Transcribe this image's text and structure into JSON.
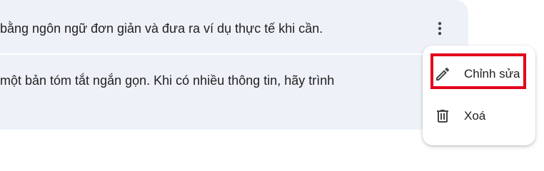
{
  "list": {
    "rows": [
      {
        "text": "bằng ngôn ngữ đơn giản và đưa ra ví dụ thực tế khi cần."
      },
      {
        "text": "một bản tóm tắt ngắn gọn. Khi có nhiều thông tin, hãy trình"
      }
    ]
  },
  "more_button": {
    "icon": "more-vertical-icon"
  },
  "context_menu": {
    "items": [
      {
        "label": "Chỉnh sửa",
        "icon": "pencil-icon"
      },
      {
        "label": "Xoá",
        "icon": "trash-icon"
      }
    ]
  },
  "colors": {
    "card_background": "#eef2f8",
    "text": "#1f1f1f",
    "icon": "#444746",
    "highlight": "#e3001b"
  }
}
